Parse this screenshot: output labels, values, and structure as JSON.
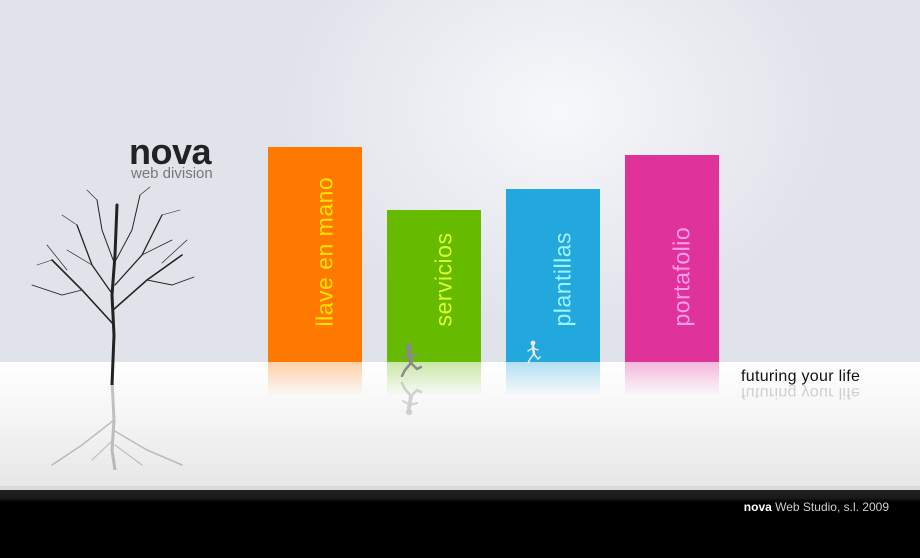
{
  "logo": {
    "name": "nova",
    "subtitle": "web division"
  },
  "nav": {
    "items": [
      {
        "label": "llave en mano",
        "color": "#ff7800",
        "text_color": "#ffe300"
      },
      {
        "label": "servicios",
        "color": "#66bb00",
        "text_color": "#d9ff2e"
      },
      {
        "label": "plantillas",
        "color": "#22a8dc",
        "text_color": "#9cf3ff"
      },
      {
        "label": "portafolio",
        "color": "#e0339a",
        "text_color": "#ff9ce8"
      }
    ]
  },
  "tagline": "futuring your life",
  "footer": {
    "brand": "nova",
    "text": "Web Studio, s.l. 2009"
  }
}
